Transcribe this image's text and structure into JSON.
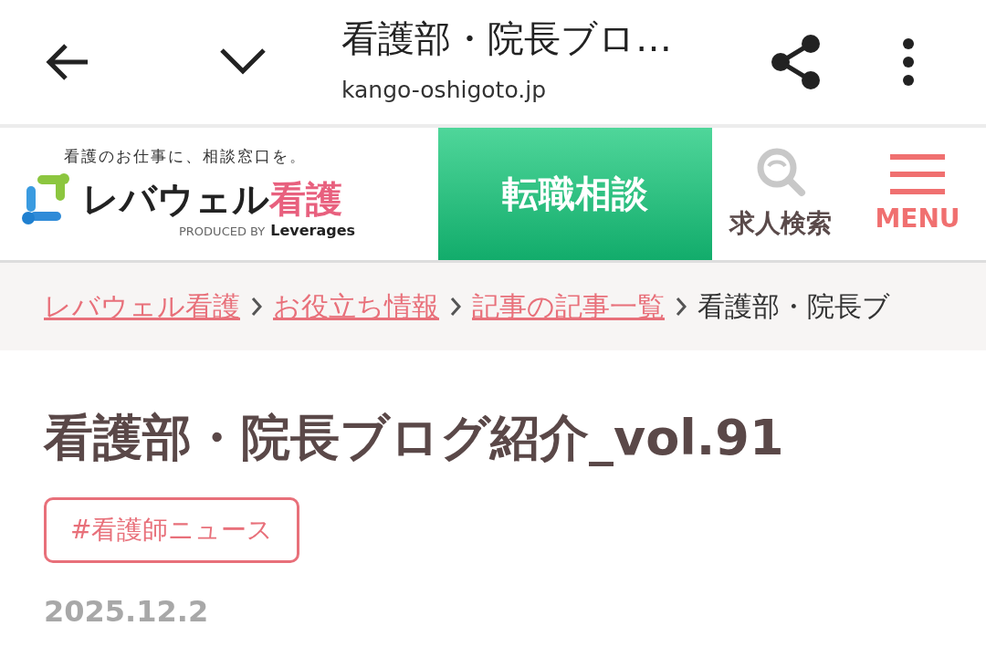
{
  "browser_bar": {
    "title": "看護部・院長ブロ…",
    "url": "kango-oshigoto.jp"
  },
  "site_header": {
    "tagline": "看護のお仕事に、相談窓口を。",
    "brand_name": "レバウェル",
    "brand_suffix": "看護",
    "produced_by": "PRODUCED BY",
    "producer": "Leverages",
    "consult_button": "転職相談",
    "search_label": "求人検索",
    "menu_label": "MENU"
  },
  "breadcrumb": [
    {
      "label": "レバウェル看護",
      "kind": "link"
    },
    {
      "label": "お役立ち情報",
      "kind": "link"
    },
    {
      "label": "記事の記事一覧",
      "kind": "link"
    },
    {
      "label": "看護部・院長ブ",
      "kind": "current"
    }
  ],
  "article": {
    "title": "看護部・院長ブログ紹介_vol.91",
    "tag": "#看護師ニュース",
    "date": "2025.12.2"
  }
}
